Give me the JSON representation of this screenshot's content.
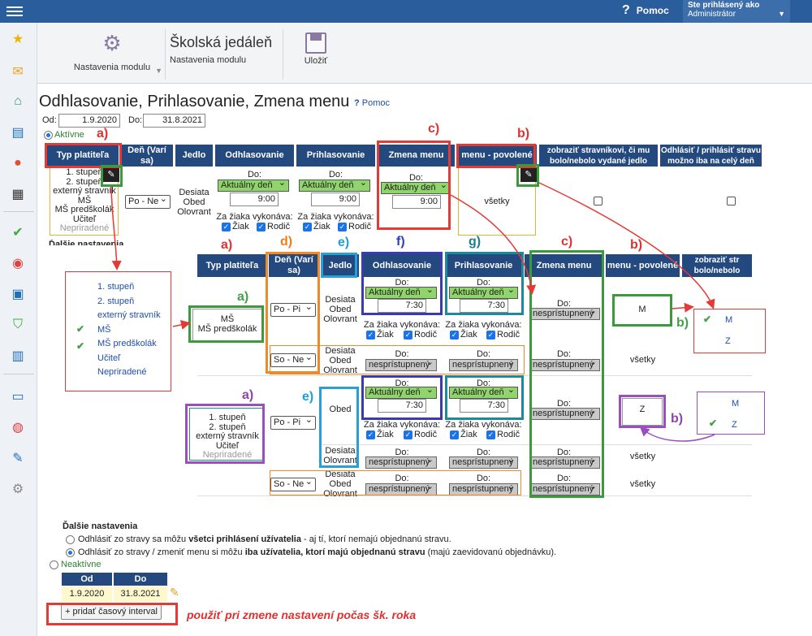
{
  "topbar": {
    "help": "Pomoc",
    "user_label": "Ste prihlásený ako",
    "user_name": "Administrátor"
  },
  "toolbar": {
    "settings_label": "Nastavenia modulu",
    "title": "Školská jedáleň",
    "subtitle": "Nastavenia modulu",
    "save_label": "Uložiť"
  },
  "page": {
    "title": "Odhlasovanie, Prihlasovanie, Zmena menu",
    "help": "Pomoc",
    "from_label": "Od:",
    "from_value": "1.9.2020",
    "to_label": "Do:",
    "to_value": "31.8.2021",
    "active_label": "Aktívne",
    "inactive_label": "Neaktívne"
  },
  "top_table": {
    "headers": [
      "Typ platiteľa",
      "Deň (Varí sa)",
      "Jedlo",
      "Odhlasovanie",
      "Prihlasovanie",
      "Zmena menu",
      "menu - povolené",
      "zobraziť stravníkovi, či mu bolo/nebolo vydané jedlo",
      "Odhlásiť / prihlásiť stravu možno iba na celý deň"
    ],
    "payer_lines": [
      "1. stupeň",
      "2. stupeň",
      "externý stravník",
      "MŠ",
      "MŠ predškolák",
      "Učiteľ",
      "Nepriradené"
    ],
    "day": "Po - Ne",
    "meal": [
      "Desiata",
      "Obed",
      "Olovrant"
    ],
    "do_label": "Do:",
    "current_day": "Aktuálny deň",
    "time": "9:00",
    "za_ziaka": "Za žiaka vykonáva:",
    "ziak": "Žiak",
    "rodic": "Rodič",
    "menu_allowed": "všetky"
  },
  "more_settings_partial": "Ďalšie nastavenia",
  "popup_list": [
    "1. stupeň",
    "2. stupeň",
    "externý stravník",
    "MŠ",
    "MŠ predškolák",
    "Učiteľ",
    "Nepriradené"
  ],
  "detail_table": {
    "headers": [
      "Typ platiteľa",
      "Deň (Varí sa)",
      "Jedlo",
      "Odhlasovanie",
      "Prihlasovanie",
      "Zmena menu",
      "menu - povolené",
      "zobraziť str bolo/nebolo"
    ],
    "group1_payer": [
      "MŠ",
      "MŠ predškolák"
    ],
    "group2_payer": [
      "1. stupeň",
      "2. stupeň",
      "externý stravník",
      "Učiteľ",
      "Nepriradené"
    ],
    "day1": "Po - Pi",
    "day2": "So - Ne",
    "meal_full": [
      "Desiata",
      "Obed",
      "Olovrant"
    ],
    "meal_obed": "Obed",
    "meal_do": [
      "Desiata",
      "Olovrant"
    ],
    "do_label": "Do:",
    "current_day": "Aktuálny deň",
    "time": "7:30",
    "unavailable": "nesprístupnený",
    "za_ziaka": "Za žiaka vykonáva:",
    "ziak": "Žiak",
    "rodic": "Rodič",
    "menu_m": "M",
    "menu_z": "Z",
    "menu_all": "všetky"
  },
  "mz_popup": [
    "M",
    "Z"
  ],
  "annotations": {
    "a": "a)",
    "b": "b)",
    "c": "c)",
    "d": "d)",
    "e": "e)",
    "f": "f)",
    "g": "g)"
  },
  "bottom": {
    "title": "Ďalšie nastavenia",
    "opt1_pre": "Odhlásiť zo stravy sa môžu ",
    "opt1_bold": "všetci prihlásení užívatelia",
    "opt1_post": " - aj tí, ktorí nemajú objednanú stravu.",
    "opt2_pre": "Odhlásiť zo stravy / zmeniť menu si môžu ",
    "opt2_bold": "iba užívatelia, ktorí majú objednanú stravu",
    "opt2_post": " (majú zaevidovanú objednávku).",
    "od": "Od",
    "do": "Do",
    "od_val": "1.9.2020",
    "do_val": "31.8.2021",
    "add_interval": "+ pridať časový interval",
    "note": "použiť pri zmene nastavení počas šk. roka"
  }
}
